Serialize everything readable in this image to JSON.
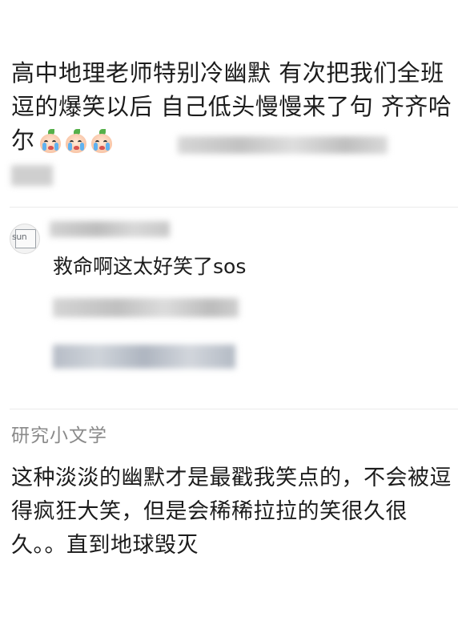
{
  "post": {
    "text": "高中地理老师特别冷幽默 有次把我们全班逗的爆笑以后 自己低头慢慢来了句 齐齐哈尔",
    "emojis": [
      "crying-face-emoji",
      "crying-face-emoji",
      "crying-face-emoji"
    ]
  },
  "reply": {
    "avatar_text": "sun",
    "text": "救命啊这太好笑了sos"
  },
  "quote": {
    "author": "研究小文学",
    "text": "这种淡淡的幽默才是最戳我笑点的，不会被逗得疯狂大笑，但是会稀稀拉拉的笑很久很久。。直到地球毁灭"
  },
  "colors": {
    "text": "#1c1c1c",
    "muted": "#8a8a8a",
    "blur_gray": "#c9c9c9"
  }
}
